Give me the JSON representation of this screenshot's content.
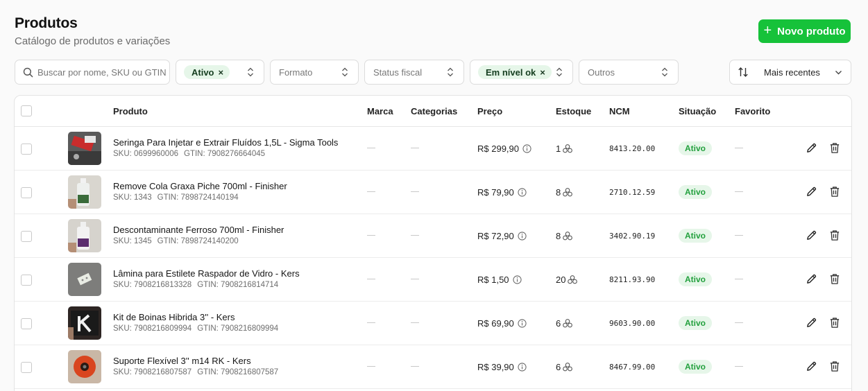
{
  "header": {
    "title": "Produtos",
    "subtitle": "Catálogo de produtos e variações",
    "new_button_label": "Novo produto"
  },
  "filters": {
    "search_placeholder": "Buscar por nome, SKU ou GTIN...",
    "ativo_chip": "Ativo",
    "formato": "Formato",
    "status_fiscal": "Status fiscal",
    "nivel_chip": "Em nível ok",
    "outros": "Outros",
    "sort_label": "Mais recentes",
    "chip_remove_glyph": "×"
  },
  "table": {
    "columns": {
      "produto": "Produto",
      "marca": "Marca",
      "categorias": "Categorias",
      "preco": "Preço",
      "estoque": "Estoque",
      "ncm": "NCM",
      "situacao": "Situação",
      "favorito": "Favorito"
    },
    "rows": [
      {
        "name": "Seringa Para Injetar e Extrair Fluídos 1,5L - Sigma Tools",
        "sku": "SKU: 0699960006",
        "gtin": "GTIN: 7908276664045",
        "price": "R$ 299,90",
        "stock": "1",
        "ncm": "8413.20.00",
        "status": "Ativo"
      },
      {
        "name": "Remove Cola Graxa Piche 700ml - Finisher",
        "sku": "SKU: 1343",
        "gtin": "GTIN: 7898724140194",
        "price": "R$ 79,90",
        "stock": "8",
        "ncm": "2710.12.59",
        "status": "Ativo"
      },
      {
        "name": "Descontaminante Ferroso 700ml - Finisher",
        "sku": "SKU: 1345",
        "gtin": "GTIN: 7898724140200",
        "price": "R$ 72,90",
        "stock": "8",
        "ncm": "3402.90.19",
        "status": "Ativo"
      },
      {
        "name": "Lâmina para Estilete Raspador de Vidro - Kers",
        "sku": "SKU: 7908216813328",
        "gtin": "GTIN: 7908216814714",
        "price": "R$ 1,50",
        "stock": "20",
        "ncm": "8211.93.90",
        "status": "Ativo"
      },
      {
        "name": "Kit de Boinas Hibrida 3'' - Kers",
        "sku": "SKU: 7908216809994",
        "gtin": "GTIN: 7908216809994",
        "price": "R$ 69,90",
        "stock": "6",
        "ncm": "9603.90.00",
        "status": "Ativo"
      },
      {
        "name": "Suporte Flexível 3'' m14 RK - Kers",
        "sku": "SKU: 7908216807587",
        "gtin": "GTIN: 7908216807587",
        "price": "R$ 39,90",
        "stock": "6",
        "ncm": "8467.99.00",
        "status": "Ativo"
      }
    ]
  },
  "icons": {
    "search": "search-icon",
    "plus": "plus-icon",
    "chevron_updown": "chevron-updown-icon",
    "sort": "sort-arrows-icon",
    "chevron_down": "chevron-down-icon",
    "info": "info-icon",
    "stock": "boxes-icon",
    "edit": "pencil-icon",
    "delete": "trash-icon"
  },
  "colors": {
    "primary": "#16c23a",
    "badge_bg": "#e6f6e9",
    "badge_text": "#22a03d"
  }
}
